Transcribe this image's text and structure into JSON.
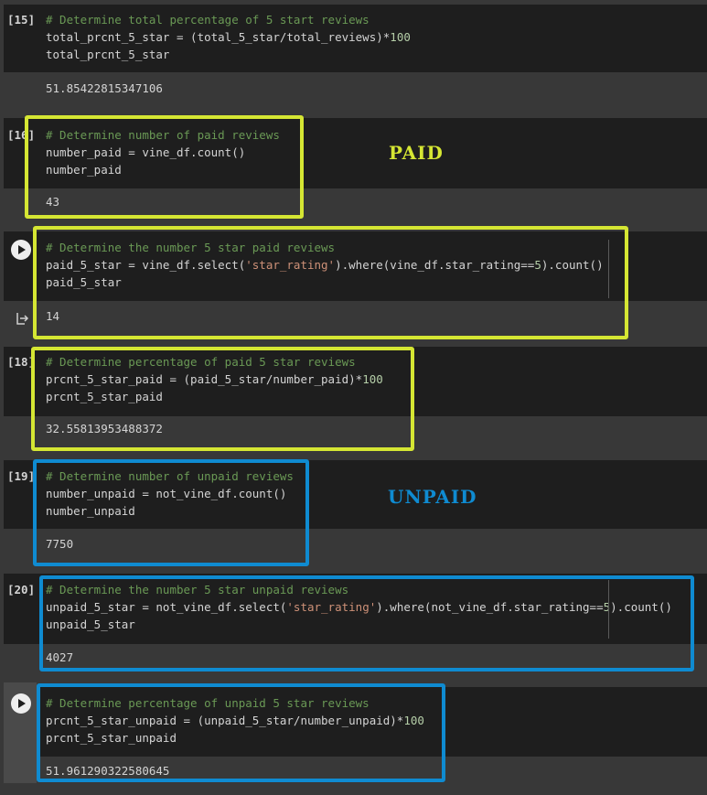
{
  "cells": [
    {
      "exec_count": "[15]",
      "lines": [
        [
          {
            "t": "# Determine total percentage of 5 start reviews",
            "c": "cmt"
          }
        ],
        [
          {
            "t": "total_prcnt_5_star = (total_5_star/total_reviews)*",
            "c": ""
          },
          {
            "t": "100",
            "c": "num"
          }
        ],
        [
          {
            "t": "total_prcnt_5_star",
            "c": ""
          }
        ]
      ],
      "output": "51.85422815347106"
    },
    {
      "exec_count": "[16]",
      "lines": [
        [
          {
            "t": "# Determine number of paid reviews",
            "c": "cmt"
          }
        ],
        [
          {
            "t": "number_paid = vine_df.count()",
            "c": ""
          }
        ],
        [
          {
            "t": "number_paid",
            "c": ""
          }
        ]
      ],
      "output": "43"
    },
    {
      "exec_count": "",
      "lines": [
        [
          {
            "t": "# Determine the number 5 star paid reviews",
            "c": "cmt"
          }
        ],
        [
          {
            "t": "paid_5_star = vine_df.select(",
            "c": ""
          },
          {
            "t": "'star_rating'",
            "c": "str"
          },
          {
            "t": ").where(vine_df.star_rating==",
            "c": ""
          },
          {
            "t": "5",
            "c": "num"
          },
          {
            "t": ").count()",
            "c": ""
          }
        ],
        [
          {
            "t": "paid_5_star",
            "c": ""
          }
        ]
      ],
      "output": "14"
    },
    {
      "exec_count": "[18]",
      "lines": [
        [
          {
            "t": "# Determine percentage of paid 5 star reviews",
            "c": "cmt"
          }
        ],
        [
          {
            "t": "prcnt_5_star_paid = (paid_5_star/number_paid)*",
            "c": ""
          },
          {
            "t": "100",
            "c": "num"
          }
        ],
        [
          {
            "t": "prcnt_5_star_paid",
            "c": ""
          }
        ]
      ],
      "output": "32.55813953488372"
    },
    {
      "exec_count": "[19]",
      "lines": [
        [
          {
            "t": "# Determine number of unpaid reviews",
            "c": "cmt"
          }
        ],
        [
          {
            "t": "number_unpaid = not_vine_df.count()",
            "c": ""
          }
        ],
        [
          {
            "t": "number_unpaid",
            "c": ""
          }
        ]
      ],
      "output": "7750"
    },
    {
      "exec_count": "[20]",
      "lines": [
        [
          {
            "t": "# Determine the number 5 star unpaid reviews",
            "c": "cmt"
          }
        ],
        [
          {
            "t": "unpaid_5_star = not_vine_df.select(",
            "c": ""
          },
          {
            "t": "'star_rating'",
            "c": "str"
          },
          {
            "t": ").where(not_vine_df.star_rating==",
            "c": ""
          },
          {
            "t": "5",
            "c": "num"
          },
          {
            "t": ").count()",
            "c": ""
          }
        ],
        [
          {
            "t": "unpaid_5_star",
            "c": ""
          }
        ]
      ],
      "output": "4027"
    },
    {
      "exec_count": "",
      "lines": [
        [
          {
            "t": "# Determine percentage of unpaid 5 star reviews",
            "c": "cmt"
          }
        ],
        [
          {
            "t": "prcnt_5_star_unpaid = (unpaid_5_star/number_unpaid)*",
            "c": ""
          },
          {
            "t": "100",
            "c": "num"
          }
        ],
        [
          {
            "t": "prcnt_5_star_unpaid",
            "c": ""
          }
        ]
      ],
      "output": "51.961290322580645"
    }
  ],
  "annotations": {
    "paid_label": "PAID",
    "unpaid_label": "UNPAID",
    "paid_color": "#d5e633",
    "unpaid_color": "#0f8bd1"
  },
  "icons": {
    "run": "play-icon",
    "output": "output-redirect-icon"
  },
  "colors": {
    "code_bg": "#1e1e1e",
    "page_bg": "#383838",
    "comment": "#6a9955",
    "string": "#ce9178",
    "number": "#b5cea8",
    "text": "#d4d4d4"
  }
}
